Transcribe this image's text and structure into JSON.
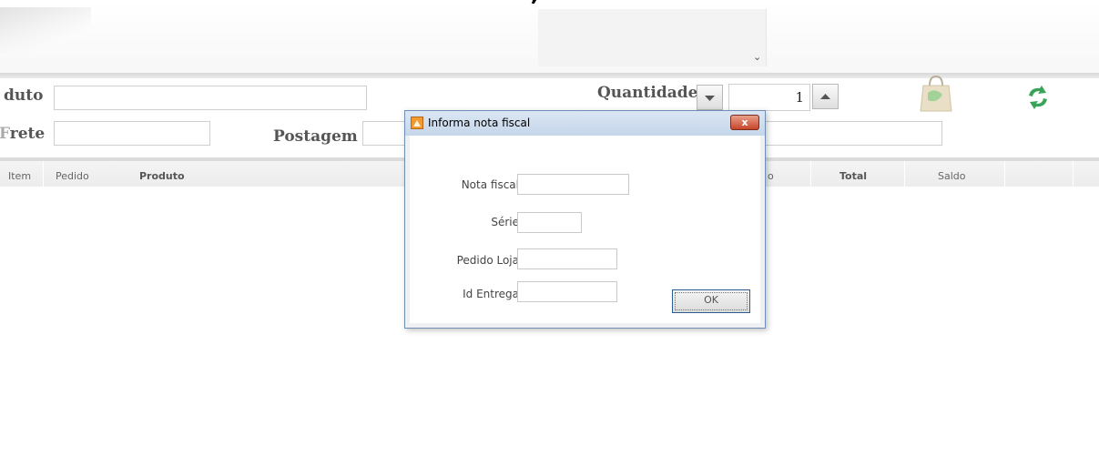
{
  "form": {
    "produto_label": "duto",
    "frete_label": "rete",
    "frete_prefix": "F",
    "postagem_label": "Postagem",
    "quantidade_label": "Quantidade",
    "quantidade_value": "1"
  },
  "grid": {
    "columns": [
      "Item",
      "Pedido",
      "Produto",
      "o",
      "Total",
      "Saldo"
    ]
  },
  "dialog": {
    "title": "Informa nota fiscal",
    "close_label": "x",
    "fields": [
      {
        "label": "Nota fiscal",
        "value": ""
      },
      {
        "label": "Série",
        "value": ""
      },
      {
        "label": "Pedido Loja",
        "value": ""
      },
      {
        "label": "Id Entrega",
        "value": ""
      }
    ],
    "ok_label": "OK"
  },
  "icons": {
    "chevron": "chevron-down-icon",
    "spin_down": "triangle-down-icon",
    "spin_up": "triangle-up-icon",
    "bag": "shopping-bag-icon",
    "refresh": "refresh-icon",
    "dialog_icon": "app-window-icon"
  },
  "colors": {
    "dialog_border": "#6f8fb4",
    "close_button": "#c8442a",
    "refresh_green": "#3aa35a"
  }
}
